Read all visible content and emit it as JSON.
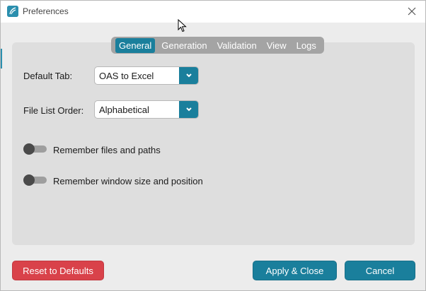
{
  "window": {
    "title": "Preferences"
  },
  "tabs": [
    {
      "label": "General",
      "active": true
    },
    {
      "label": "Generation",
      "active": false
    },
    {
      "label": "Validation",
      "active": false
    },
    {
      "label": "View",
      "active": false
    },
    {
      "label": "Logs",
      "active": false
    }
  ],
  "general": {
    "default_tab": {
      "label": "Default Tab:",
      "value": "OAS to Excel"
    },
    "file_list_order": {
      "label": "File List Order:",
      "value": "Alphabetical"
    },
    "remember_files": {
      "label": "Remember files and paths",
      "on": false
    },
    "remember_window": {
      "label": "Remember window size and position",
      "on": false
    }
  },
  "buttons": {
    "reset": "Reset to Defaults",
    "apply": "Apply & Close",
    "cancel": "Cancel"
  },
  "colors": {
    "accent": "#1a7f9c",
    "danger": "#d9424a"
  },
  "icons": {
    "app": "app-logo-icon",
    "close": "close-icon",
    "dropdown": "chevron-down-icon"
  }
}
